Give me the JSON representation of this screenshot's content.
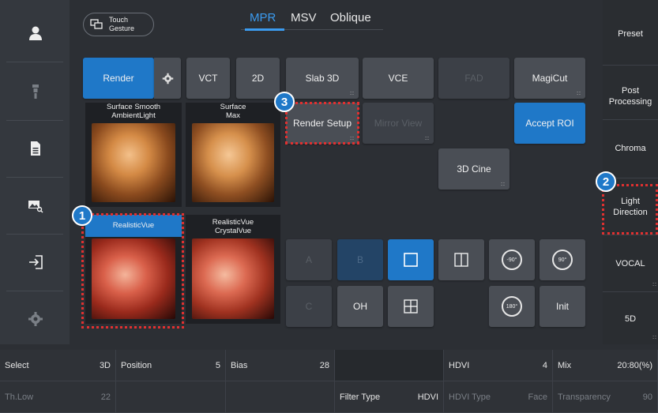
{
  "touch_gesture": {
    "label_line1": "Touch",
    "label_line2": "Gesture"
  },
  "tabs": [
    {
      "label": "MPR",
      "active": true
    },
    {
      "label": "MSV",
      "active": false
    },
    {
      "label": "Oblique",
      "active": false
    }
  ],
  "left_sidebar": {
    "icons": [
      "user-icon",
      "probe-icon",
      "document-icon",
      "image-search-icon",
      "exit-icon",
      "gear-icon"
    ]
  },
  "right_sidebar": [
    {
      "line1": "Preset",
      "line2": ""
    },
    {
      "line1": "Post",
      "line2": "Processing"
    },
    {
      "line1": "Chroma",
      "line2": ""
    },
    {
      "line1": "Light",
      "line2": "Direction"
    },
    {
      "line1": "VOCAL",
      "line2": ""
    },
    {
      "line1": "5D",
      "line2": ""
    }
  ],
  "toolbar": {
    "render": "Render",
    "vct": "VCT",
    "two_d": "2D",
    "slab_3d": "Slab 3D",
    "vce": "VCE",
    "fad": "FAD",
    "magicut": "MagiCut",
    "render_setup": "Render Setup",
    "mirror_view": "Mirror View",
    "accept_roi": "Accept ROI",
    "cine_3d": "3D Cine",
    "a": "A",
    "b": "B",
    "c": "C",
    "oh": "OH",
    "init": "Init",
    "rot_minus90": "-90°",
    "rot_90": "90°",
    "rot_180": "180°"
  },
  "thumbnails": [
    {
      "line1": "Surface Smooth",
      "line2": "AmbientLight"
    },
    {
      "line1": "Surface",
      "line2": "Max"
    },
    {
      "line1": "RealisticVue",
      "line2": ""
    },
    {
      "line1": "RealisticVue",
      "line2": "CrystalVue"
    }
  ],
  "badges": [
    "1",
    "2",
    "3"
  ],
  "params_row1": [
    {
      "label": "Select",
      "value": "3D"
    },
    {
      "label": "Position",
      "value": "5"
    },
    {
      "label": "Bias",
      "value": "28"
    },
    {
      "label": "",
      "value": ""
    },
    {
      "label": "HDVI",
      "value": "4"
    },
    {
      "label": "Mix",
      "value": "20:80(%)"
    }
  ],
  "params_row2": [
    {
      "label": "Th.Low",
      "value": "22"
    },
    {
      "label": "",
      "value": ""
    },
    {
      "label": "",
      "value": ""
    },
    {
      "label": "Filter Type",
      "value": "HDVI"
    },
    {
      "label": "HDVI Type",
      "value": "Face"
    },
    {
      "label": "Transparency",
      "value": "90"
    }
  ],
  "colors": {
    "accent": "#1f78c8",
    "highlight": "#e03030",
    "tab_active": "#3b9bef"
  }
}
